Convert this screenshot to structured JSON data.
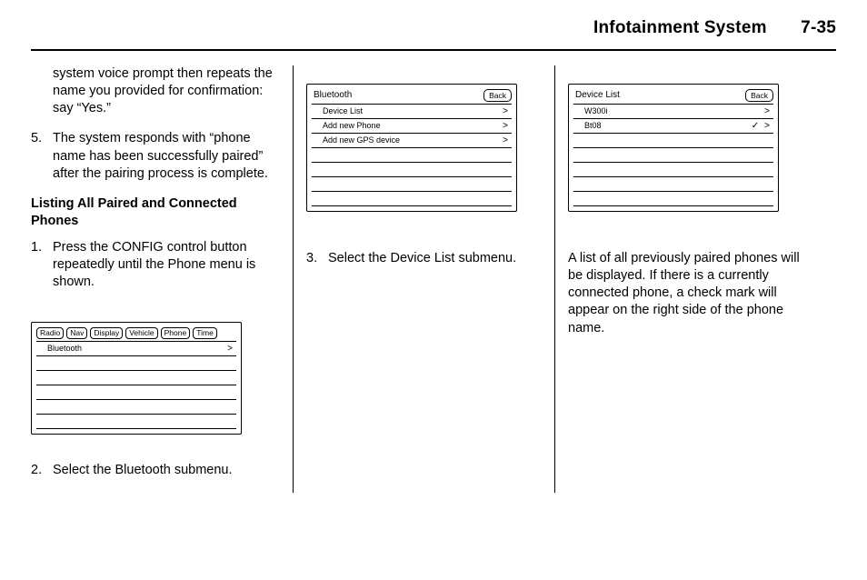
{
  "header": {
    "title": "Infotainment System",
    "page_number": "7-35"
  },
  "column1": {
    "continuation": "system voice prompt then repeats the name you provided for confirmation: say “Yes.”",
    "step5_num": "5.",
    "step5_txt": "The system responds with “phone name has been successfully paired” after the pairing process is complete.",
    "subhead": "Listing All Paired and Connected Phones",
    "step1_num": "1.",
    "step1_txt": "Press the CONFIG control button repeatedly until the Phone menu is shown.",
    "step2_num": "2.",
    "step2_txt": "Select the Bluetooth submenu."
  },
  "column2": {
    "step3_num": "3.",
    "step3_txt": "Select the Device List submenu."
  },
  "column3": {
    "para": "A list of all previously paired phones will be displayed. If there is a currently connected phone, a check mark will appear on the right side of the phone name."
  },
  "screen1": {
    "tabs": [
      "Radio",
      "Nav",
      "Display",
      "Vehicle",
      "Phone",
      "Time"
    ],
    "rows": [
      {
        "label": "Bluetooth",
        "chevron": true
      }
    ]
  },
  "screen2": {
    "title": "Bluetooth",
    "back": "Back",
    "rows": [
      {
        "label": "Device List",
        "chevron": true
      },
      {
        "label": "Add new Phone",
        "chevron": true
      },
      {
        "label": "Add new GPS device",
        "chevron": true
      }
    ]
  },
  "screen3": {
    "title": "Device List",
    "back": "Back",
    "rows": [
      {
        "label": "W300i",
        "chevron": true,
        "check": false
      },
      {
        "label": "Bt08",
        "chevron": true,
        "check": true
      }
    ]
  }
}
